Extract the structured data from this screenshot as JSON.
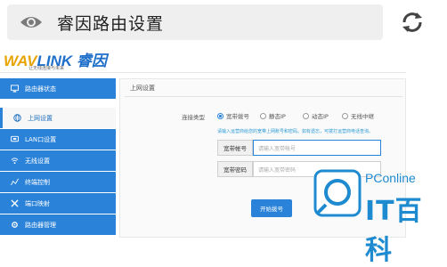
{
  "browser": {
    "page_title": "睿因路由设置",
    "eye_icon": "eye-icon",
    "reload_icon": "reload-icon"
  },
  "router": {
    "logo_main": "LINK",
    "logo_prefix": "WAV",
    "logo_brand": "睿因",
    "logo_sub": "让无线连接与未来"
  },
  "sidebar": {
    "items": [
      {
        "label": "路由器状态",
        "icon": "monitor-icon",
        "active": false
      },
      {
        "label": "上网设置",
        "icon": "globe-icon",
        "active": true
      },
      {
        "label": "LAN口设置",
        "icon": "lan-icon",
        "active": false
      },
      {
        "label": "无线设置",
        "icon": "wifi-icon",
        "active": false
      },
      {
        "label": "终端控制",
        "icon": "chart-icon",
        "active": false
      },
      {
        "label": "端口映射",
        "icon": "tools-icon",
        "active": false
      },
      {
        "label": "路由器管理",
        "icon": "gear-icon",
        "active": false
      }
    ]
  },
  "panel": {
    "title": "上网设置",
    "conn_type_label": "连接类型",
    "conn_options": [
      "宽带拨号",
      "静态IP",
      "动态IP",
      "无线中继"
    ],
    "selected_option": "宽带拨号",
    "hint": "请输入运营商给您的宽带上网账号和密码。如有遗忘，可拨打运营商电话查询。",
    "account_label": "宽带帐号",
    "account_placeholder": "请输入宽带帐号",
    "password_label": "宽带密码",
    "password_placeholder": "请输入宽带密码",
    "connect_label": "开始拨号"
  },
  "watermark": {
    "pconline": "PConline",
    "itbaike": "IT百科"
  },
  "colors": {
    "accent": "#2a82d9",
    "watermark": "#1e8ad0"
  }
}
